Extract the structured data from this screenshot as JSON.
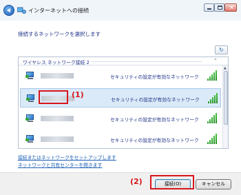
{
  "window": {
    "title": "インターネットへの接続"
  },
  "heading": "接続するネットワークを選択します",
  "network_group": {
    "title": "ワイヤレス ネットワーク接続 2",
    "networks": [
      {
        "security": "セキュリティの設定が有効なネットワーク",
        "signal_bars": 5,
        "selected": false
      },
      {
        "security": "セキュリティの設定が有効なネットワーク",
        "signal_bars": 5,
        "selected": true
      },
      {
        "security": "セキュリティの設定が有効なネットワーク",
        "signal_bars": 5,
        "selected": false
      },
      {
        "security": "セキュリティの設定が有効なネットワーク",
        "signal_bars": 5,
        "selected": false
      }
    ]
  },
  "links": {
    "setup": "接続またはネットワークをセットアップします",
    "network_center": "ネットワークと共有センターを開きます"
  },
  "buttons": {
    "connect": "接続(O)",
    "cancel": "キャンセル"
  },
  "annotations": {
    "marker1": "(1)",
    "marker2": "(2)"
  },
  "colors": {
    "marker": "#d8141a",
    "link": "#1a5fb4",
    "selected_row": "#dbeaf8"
  }
}
